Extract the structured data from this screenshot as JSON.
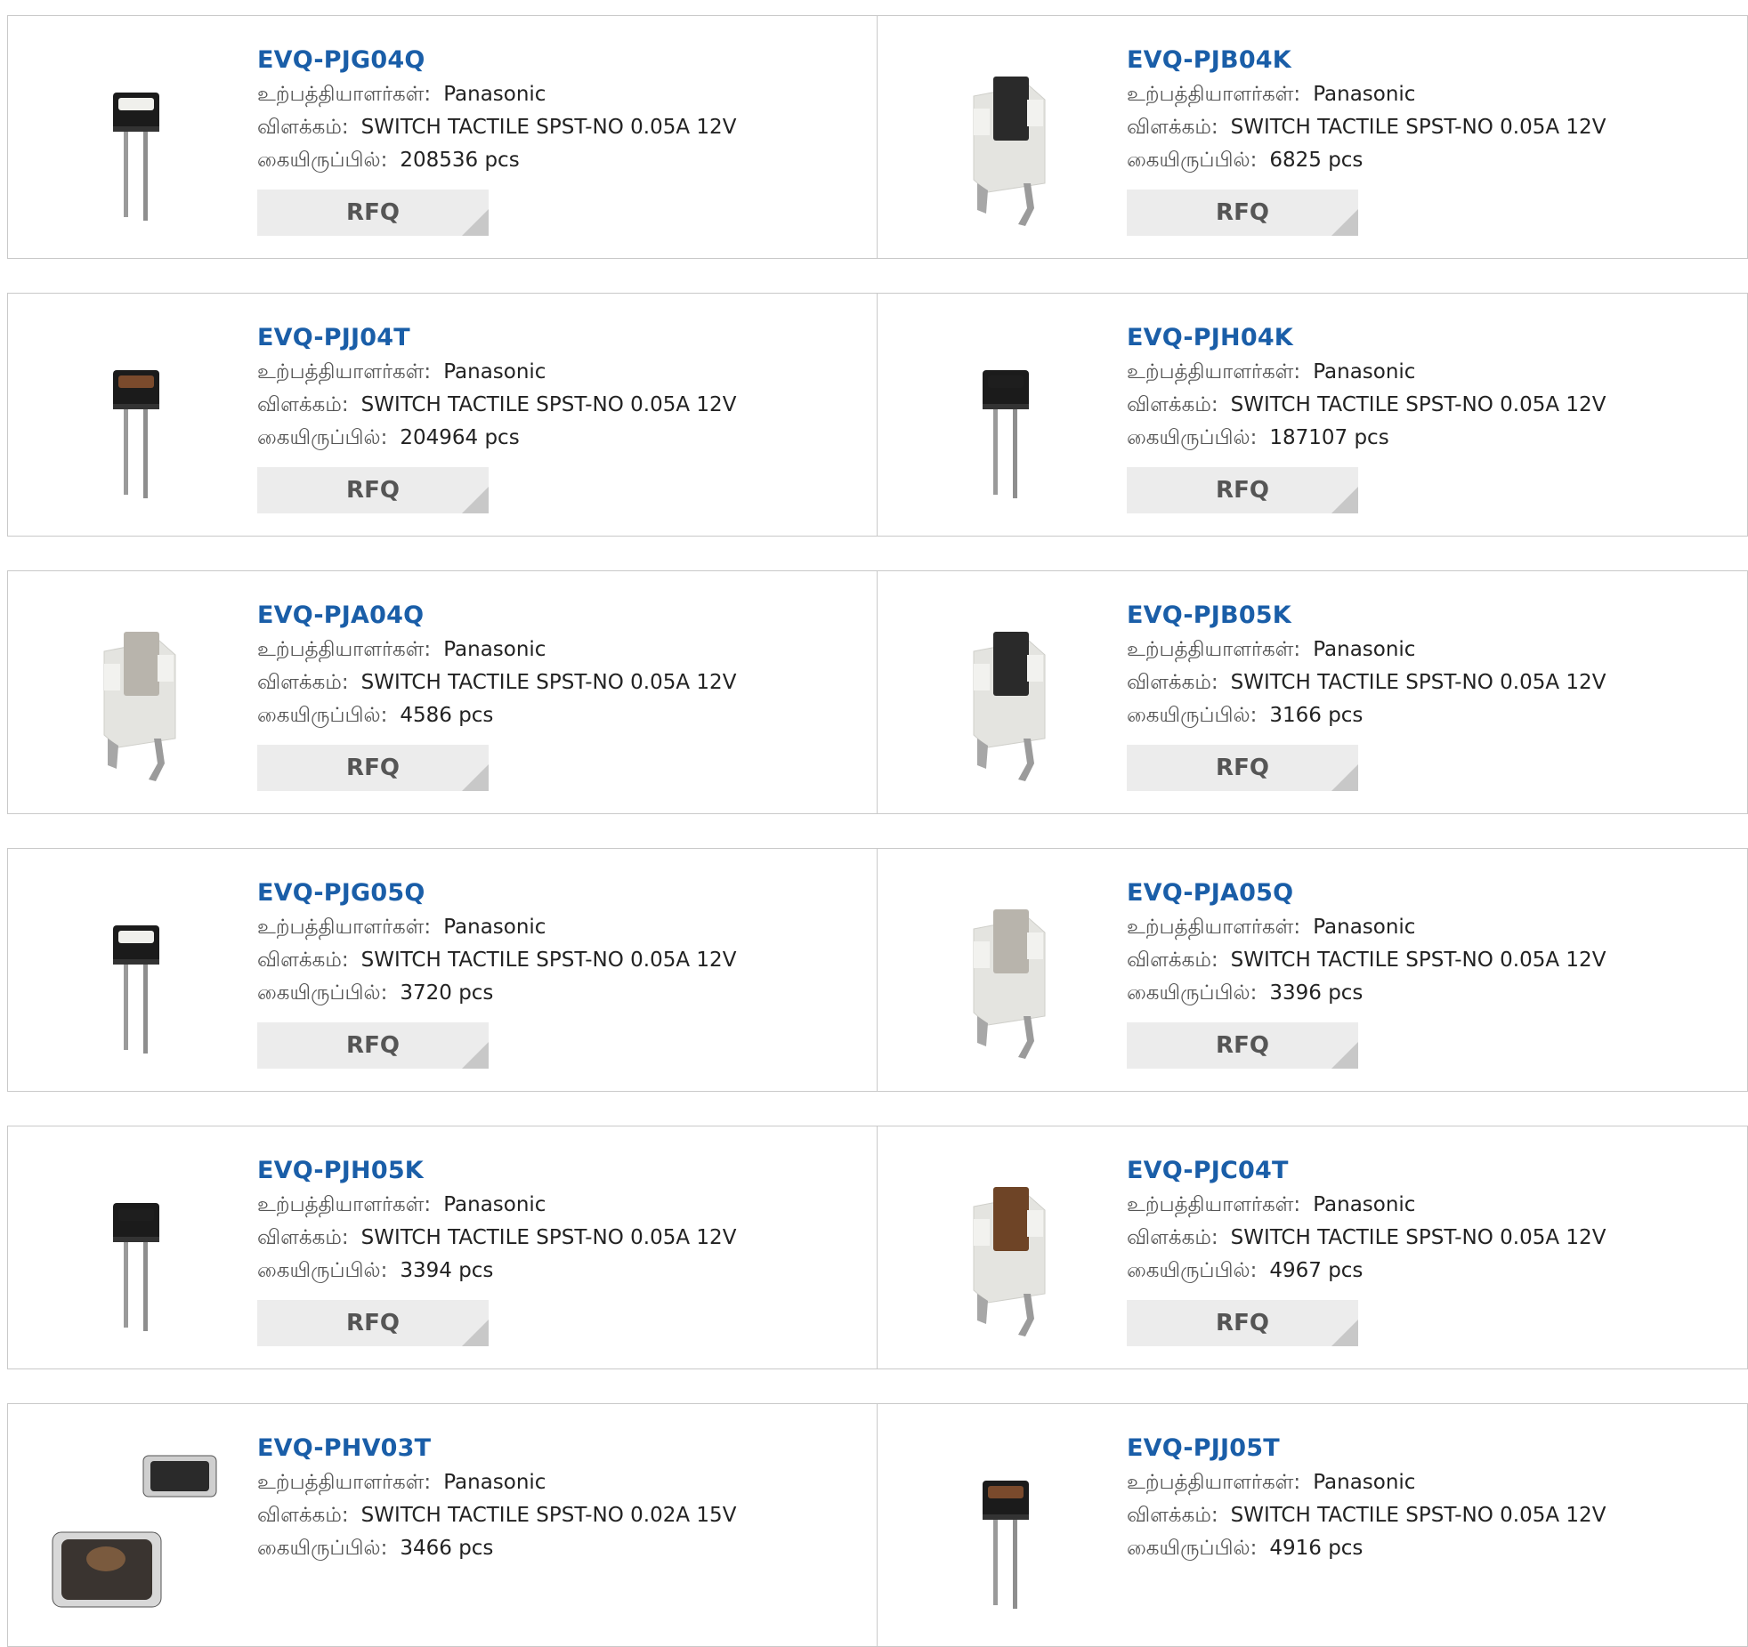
{
  "labels": {
    "manufacturer": "உற்பத்தியாளர்கள்:",
    "description": "விளக்கம்:",
    "stock": "கையிருப்பில்:",
    "rfq": "RFQ"
  },
  "colors": {
    "part_link": "#1a5ea8",
    "rfq_bg": "#ececec",
    "border": "#c9c9c9"
  },
  "products": [
    {
      "part": "EVQ-PJG04Q",
      "manufacturer": "Panasonic",
      "description": "SWITCH TACTILE SPST-NO 0.05A 12V",
      "stock": "208536 pcs",
      "image_icon": "tactile-switch-vertical-white-actuator-icon"
    },
    {
      "part": "EVQ-PJB04K",
      "manufacturer": "Panasonic",
      "description": "SWITCH TACTILE SPST-NO 0.05A 12V",
      "stock": "6825 pcs",
      "image_icon": "tactile-switch-right-angle-black-actuator-icon"
    },
    {
      "part": "EVQ-PJJ04T",
      "manufacturer": "Panasonic",
      "description": "SWITCH TACTILE SPST-NO 0.05A 12V",
      "stock": "204964 pcs",
      "image_icon": "tactile-switch-vertical-brown-actuator-icon"
    },
    {
      "part": "EVQ-PJH04K",
      "manufacturer": "Panasonic",
      "description": "SWITCH TACTILE SPST-NO 0.05A 12V",
      "stock": "187107 pcs",
      "image_icon": "tactile-switch-vertical-black-actuator-icon"
    },
    {
      "part": "EVQ-PJA04Q",
      "manufacturer": "Panasonic",
      "description": "SWITCH TACTILE SPST-NO 0.05A 12V",
      "stock": "4586 pcs",
      "image_icon": "tactile-switch-right-angle-grey-actuator-icon"
    },
    {
      "part": "EVQ-PJB05K",
      "manufacturer": "Panasonic",
      "description": "SWITCH TACTILE SPST-NO 0.05A 12V",
      "stock": "3166 pcs",
      "image_icon": "tactile-switch-right-angle-black-actuator-icon"
    },
    {
      "part": "EVQ-PJG05Q",
      "manufacturer": "Panasonic",
      "description": "SWITCH TACTILE SPST-NO 0.05A 12V",
      "stock": "3720 pcs",
      "image_icon": "tactile-switch-vertical-white-actuator-icon"
    },
    {
      "part": "EVQ-PJA05Q",
      "manufacturer": "Panasonic",
      "description": "SWITCH TACTILE SPST-NO 0.05A 12V",
      "stock": "3396 pcs",
      "image_icon": "tactile-switch-right-angle-grey-actuator-icon"
    },
    {
      "part": "EVQ-PJH05K",
      "manufacturer": "Panasonic",
      "description": "SWITCH TACTILE SPST-NO 0.05A 12V",
      "stock": "3394 pcs",
      "image_icon": "tactile-switch-vertical-black-actuator-icon"
    },
    {
      "part": "EVQ-PJC04T",
      "manufacturer": "Panasonic",
      "description": "SWITCH TACTILE SPST-NO 0.05A 12V",
      "stock": "4967 pcs",
      "image_icon": "tactile-switch-right-angle-brown-actuator-icon"
    },
    {
      "part": "EVQ-PHV03T",
      "manufacturer": "Panasonic",
      "description": "SWITCH TACTILE SPST-NO 0.02A 15V",
      "stock": "3466 pcs",
      "image_icon": "tactile-switch-smd-pair-icon"
    },
    {
      "part": "EVQ-PJJ05T",
      "manufacturer": "Panasonic",
      "description": "SWITCH TACTILE SPST-NO 0.05A 12V",
      "stock": "4916 pcs",
      "image_icon": "tactile-switch-vertical-brown-actuator-icon"
    }
  ]
}
